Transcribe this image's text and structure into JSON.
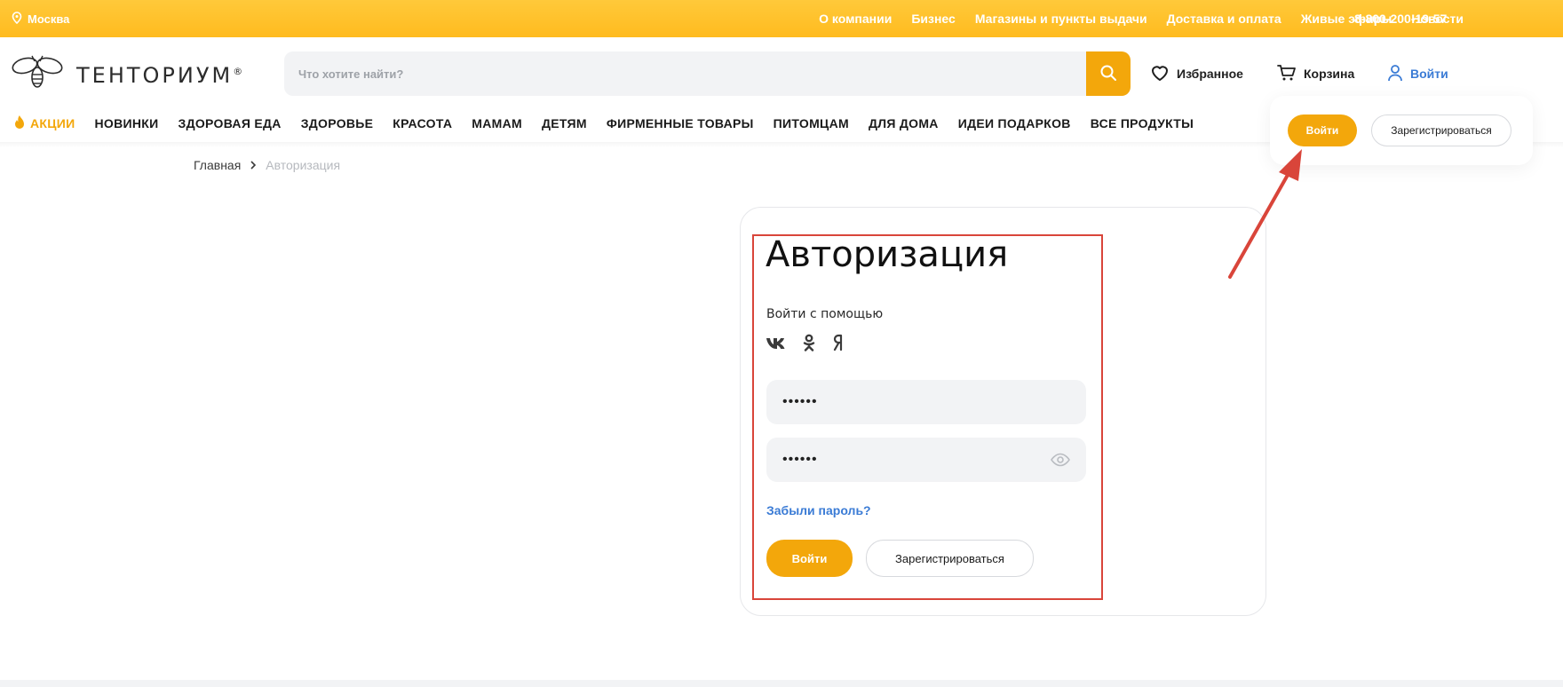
{
  "topbar": {
    "city": "Москва",
    "links": [
      "О компании",
      "Бизнес",
      "Магазины и пункты выдачи",
      "Доставка и оплата",
      "Живые эфиры",
      "Новости"
    ],
    "phone": "8-800-200-19-57"
  },
  "header": {
    "logo_text": "ТЕНТОРИУМ",
    "logo_mark": "®",
    "search_placeholder": "Что хотите найти?",
    "favorites": "Избранное",
    "cart": "Корзина",
    "login": "Войти"
  },
  "nav": {
    "items": [
      "АКЦИИ",
      "НОВИНКИ",
      "ЗДОРОВАЯ ЕДА",
      "ЗДОРОВЬЕ",
      "КРАСОТА",
      "МАМАМ",
      "ДЕТЯМ",
      "ФИРМЕННЫЕ ТОВАРЫ",
      "ПИТОМЦАМ",
      "ДЛЯ ДОМА",
      "ИДЕИ ПОДАРКОВ",
      "ВСЕ ПРОДУКТЫ"
    ]
  },
  "popup": {
    "login": "Войти",
    "register": "Зарегистрироваться"
  },
  "breadcrumb": {
    "home": "Главная",
    "current": "Авторизация"
  },
  "auth": {
    "title": "Авторизация",
    "via_label": "Войти с помощью",
    "social": [
      "ВК",
      "ОК",
      "Я"
    ],
    "login_value": "••••••",
    "password_value": "••••••",
    "forgot": "Забыли пароль?",
    "login_button": "Войти",
    "register_button": "Зарегистрироваться"
  },
  "colors": {
    "accent": "#f3a70b",
    "topbar": "#ffbb1f",
    "link": "#3a7bd5",
    "annotation": "#d9453a"
  }
}
